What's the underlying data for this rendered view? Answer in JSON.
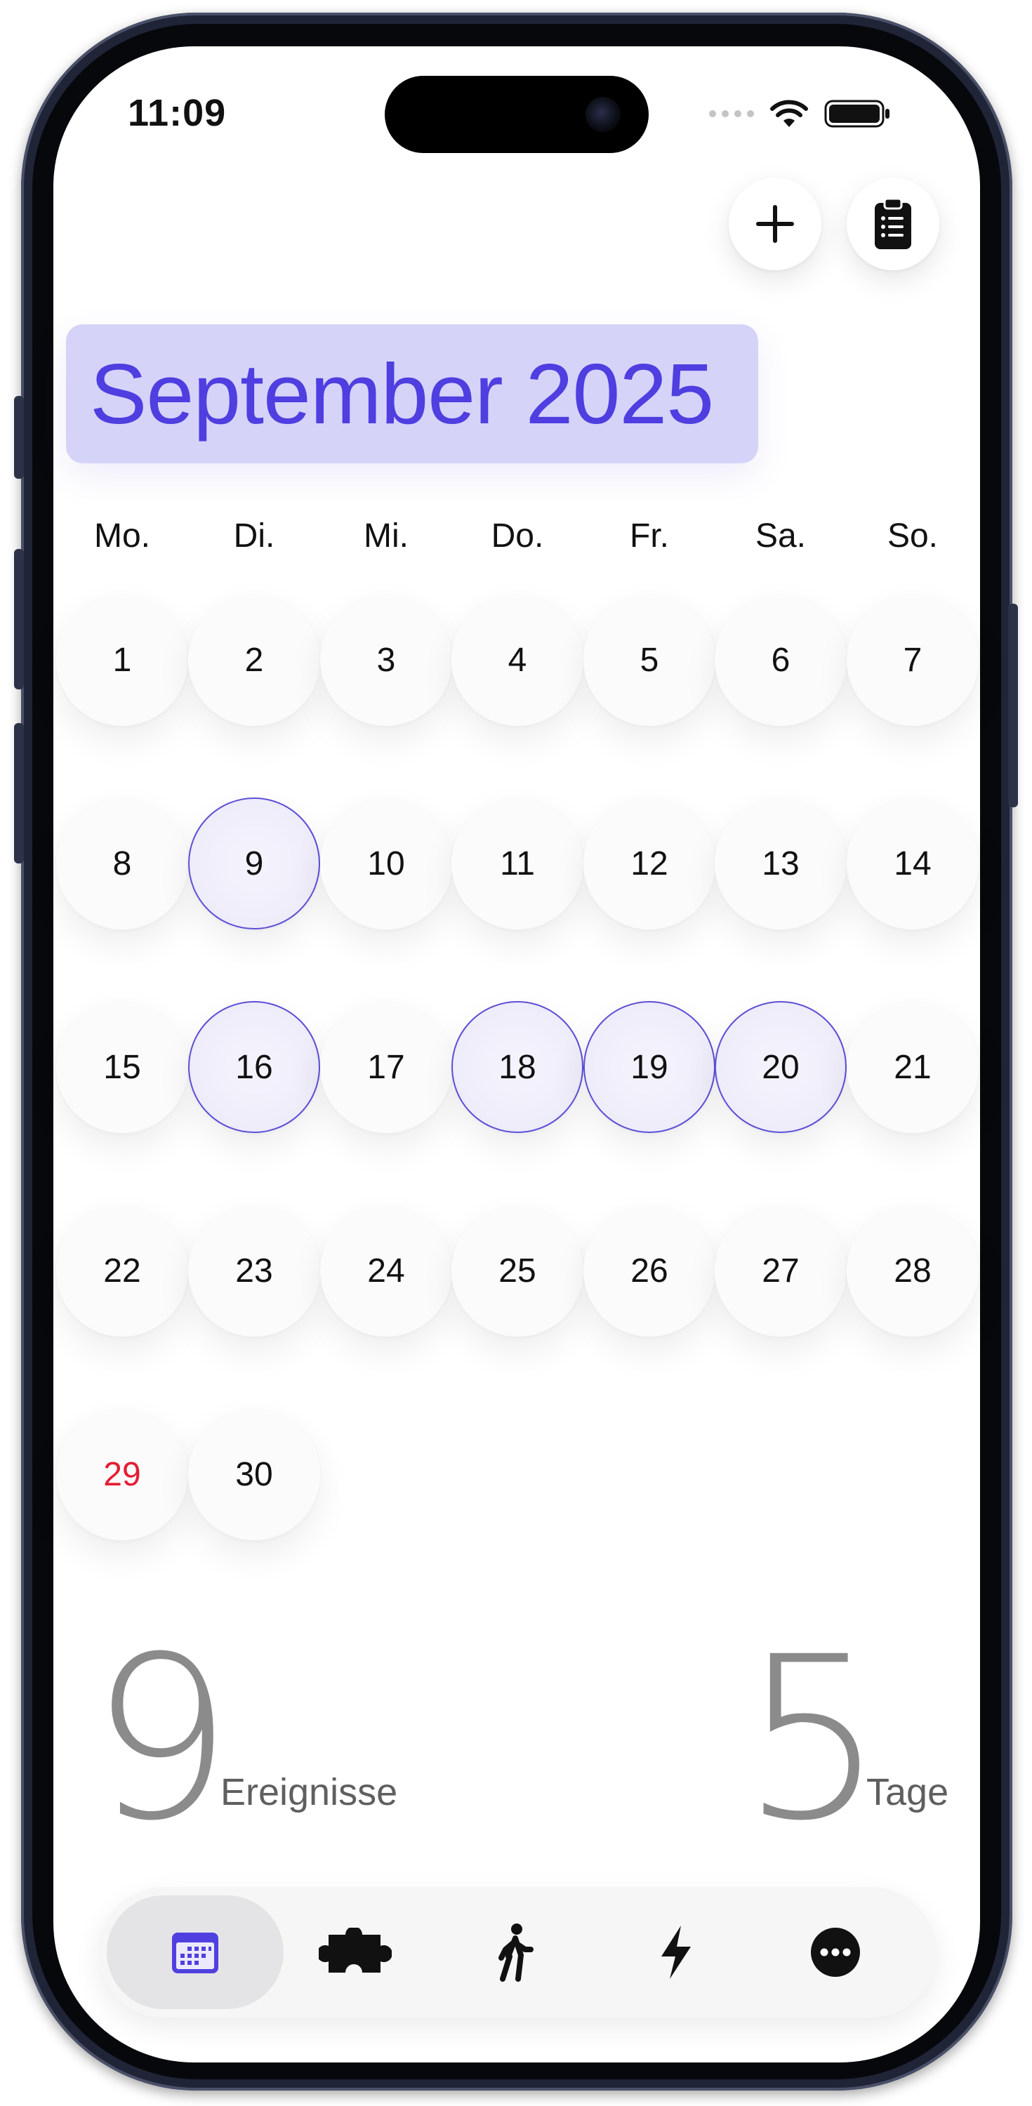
{
  "status_bar": {
    "time": "11:09"
  },
  "calendar": {
    "month_title": "September 2025",
    "weekdays": [
      "Mo.",
      "Di.",
      "Mi.",
      "Do.",
      "Fr.",
      "Sa.",
      "So."
    ],
    "days": [
      "1",
      "2",
      "3",
      "4",
      "5",
      "6",
      "7",
      "8",
      "9",
      "10",
      "11",
      "12",
      "13",
      "14",
      "15",
      "16",
      "17",
      "18",
      "19",
      "20",
      "21",
      "22",
      "23",
      "24",
      "25",
      "26",
      "27",
      "28",
      "29",
      "30"
    ],
    "event_days": [
      9,
      16,
      18,
      19,
      20
    ],
    "highlight_red_day": 29
  },
  "stats": {
    "events_count": "9",
    "events_label": "Ereignisse",
    "days_count": "5",
    "days_label": "Tage"
  },
  "icons": {
    "add": "plus-icon",
    "list": "clipboard-icon",
    "tabs": [
      "calendar-icon",
      "puzzle-icon",
      "walking-icon",
      "bolt-icon",
      "more-icon"
    ]
  },
  "colors": {
    "accent": "#4f3ee0",
    "month_pill_bg": "#d6d3f9",
    "event_ring": "#5b4fd6",
    "red_day": "#e51c32"
  }
}
